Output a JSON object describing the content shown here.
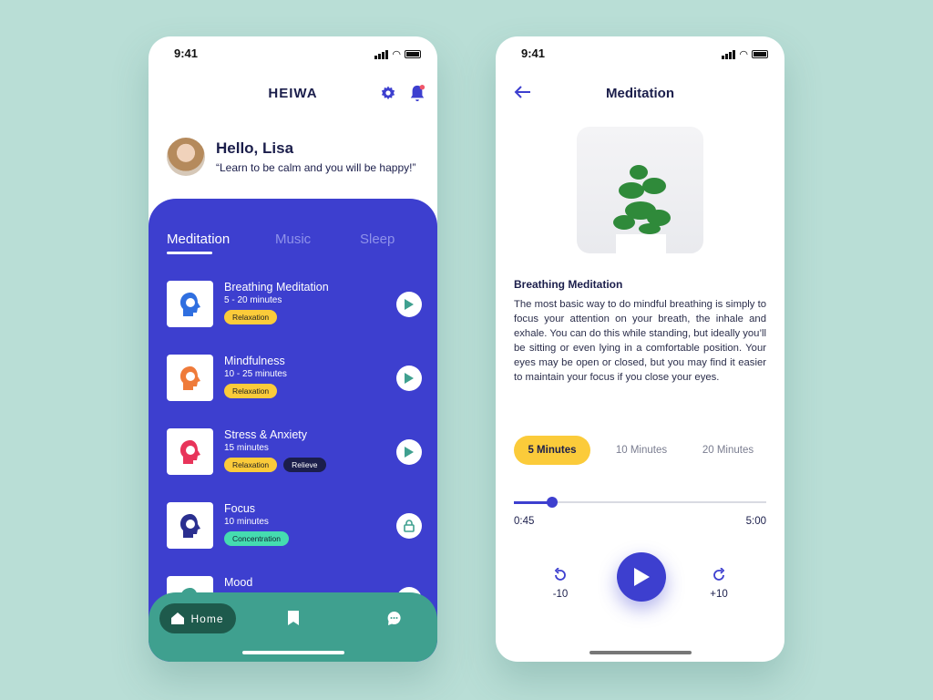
{
  "colors": {
    "background": "#b9ded6",
    "primary": "#3d3fcf",
    "teal": "#3fa08f",
    "yellow": "#fbcb3a",
    "mint": "#45dcb0",
    "navy": "#1b1e4b"
  },
  "left": {
    "status_time": "9:41",
    "brand": "HEIWA",
    "header_icons": [
      "gear-icon",
      "bell-icon"
    ],
    "greeting": "Hello, Lisa",
    "quote": "“Learn to be calm and you will be happy!”",
    "tabs": [
      {
        "label": "Meditation",
        "active": true
      },
      {
        "label": "Music"
      },
      {
        "label": "Sleep"
      }
    ],
    "items": [
      {
        "title": "Breathing Meditation",
        "duration": "5 - 20 minutes",
        "tags": [
          "Relaxation"
        ],
        "action": "play",
        "icon_color": "#2f6fe0"
      },
      {
        "title": "Mindfulness",
        "duration": "10 - 25 minutes",
        "tags": [
          "Relaxation"
        ],
        "action": "play",
        "icon_color": "#ef7b3a"
      },
      {
        "title": "Stress & Anxiety",
        "duration": "15 minutes",
        "tags": [
          "Relaxation",
          "Relieve"
        ],
        "action": "play",
        "icon_color": "#e8345a"
      },
      {
        "title": "Focus",
        "duration": "10 minutes",
        "tags": [
          "Concentration"
        ],
        "action": "lock",
        "icon_color": "#2a2f8f"
      },
      {
        "title": "Mood",
        "duration": "",
        "tags": [],
        "action": "play",
        "icon_color": "#3fa08f"
      }
    ],
    "nav": {
      "home": "Home"
    }
  },
  "right": {
    "status_time": "9:41",
    "title": "Meditation",
    "detail_title": "Breathing Meditation",
    "description": "The most basic way to do mindful breathing is simply to focus your attention on your breath, the inhale and exhale. You can do this while standing, but ideally you’ll be sitting or even lying in a comfortable position. Your eyes may be open or closed, but you may find it easier to maintain your focus if you close your eyes.",
    "durations": [
      {
        "label": "5 Minutes",
        "selected": true
      },
      {
        "label": "10 Minutes"
      },
      {
        "label": "20 Minutes"
      }
    ],
    "progress": {
      "current": "0:45",
      "total": "5:00",
      "fraction": 0.15
    },
    "rewind": "-10",
    "forward": "+10"
  }
}
